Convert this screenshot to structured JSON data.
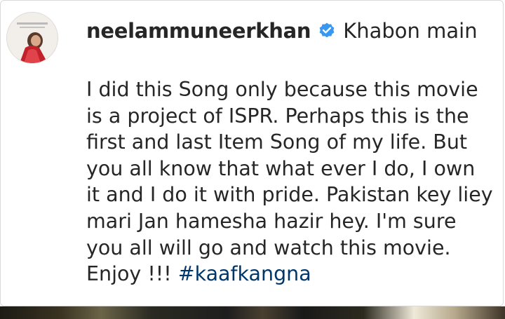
{
  "post": {
    "username": "neelammuneerkhan",
    "verified_icon": "verified-badge-icon",
    "title": "Khabon main",
    "caption": "I did this Song only because this movie is a project of ISPR. Perhaps this is the first and last Item Song of my life. But you all know that what ever I do, I own it and I do it with pride. Pakistan key liey mari Jan hamesha hazir hey. I'm sure you all will go and watch this movie. Enjoy !!! ",
    "hashtag": "#kaafkangna"
  },
  "colors": {
    "text": "#262626",
    "hashtag": "#00376b",
    "verified": "#3897f0"
  }
}
